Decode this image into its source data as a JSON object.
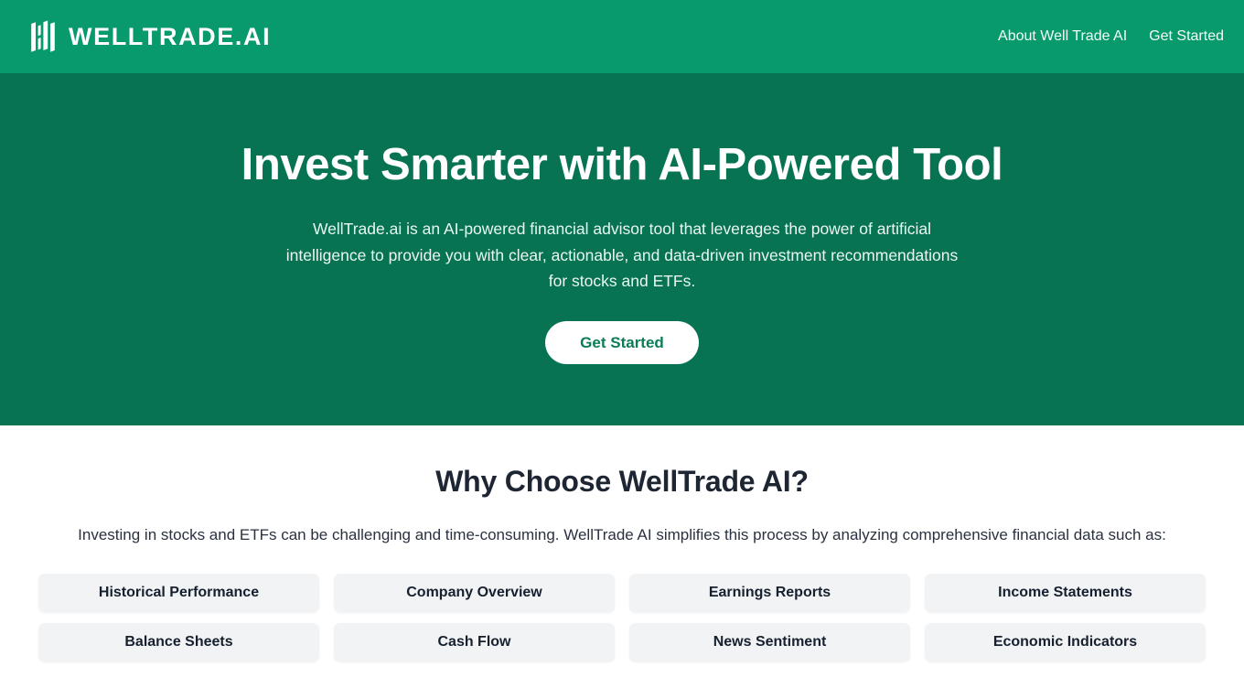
{
  "brand": {
    "name": "WELLTRADE.AI",
    "logo_icon": "bar-chart-monogram-icon",
    "header_bg": "#089a6c"
  },
  "nav": {
    "links": [
      {
        "label": "About Well Trade AI"
      },
      {
        "label": "Get Started"
      }
    ]
  },
  "hero": {
    "title": "Invest Smarter with AI-Powered Tool",
    "subtitle": "WellTrade.ai is an AI-powered financial advisor tool that leverages the power of artificial intelligence to provide you with clear, actionable, and data-driven investment recommendations for stocks and ETFs.",
    "cta_label": "Get Started",
    "bg": "#077352",
    "cta_text_color": "#0a7d57"
  },
  "features": {
    "title": "Why Choose WellTrade AI?",
    "subtitle": "Investing in stocks and ETFs can be challenging and time-consuming. WellTrade AI simplifies this process by analyzing comprehensive financial data such as:",
    "cards": [
      {
        "label": "Historical Performance"
      },
      {
        "label": "Company Overview"
      },
      {
        "label": "Earnings Reports"
      },
      {
        "label": "Income Statements"
      },
      {
        "label": "Balance Sheets"
      },
      {
        "label": "Cash Flow"
      },
      {
        "label": "News Sentiment"
      },
      {
        "label": "Economic Indicators"
      }
    ],
    "card_bg": "#f1f3f5"
  }
}
